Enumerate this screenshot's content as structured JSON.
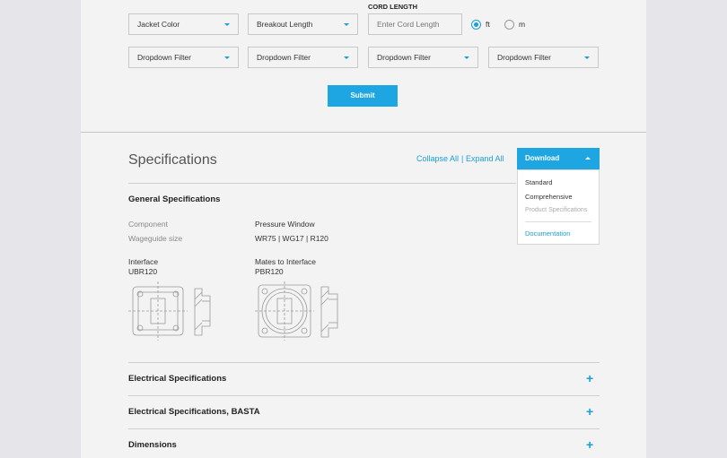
{
  "filters": {
    "row1": [
      {
        "label": "Jacket Color"
      },
      {
        "label": "Breakout Length"
      }
    ],
    "cord_length": {
      "heading": "CORD LENGTH",
      "placeholder": "Enter Cord Length",
      "units": [
        {
          "label": "ft",
          "selected": true
        },
        {
          "label": "m",
          "selected": false
        }
      ]
    },
    "row2": [
      {
        "label": "Dropdown Filter"
      },
      {
        "label": "Dropdown Filter"
      },
      {
        "label": "Dropdown Filter"
      },
      {
        "label": "Dropdown Filter"
      }
    ],
    "submit_label": "Submit"
  },
  "specifications": {
    "title": "Specifications",
    "collapse_all": "Collapse All",
    "separator": "|",
    "expand_all": "Expand All",
    "download": {
      "label": "Download",
      "items": [
        {
          "label": "Standard",
          "enabled": true
        },
        {
          "label": "Comprehensive",
          "enabled": true
        },
        {
          "label": "Product Specifications",
          "enabled": false
        }
      ],
      "documentation": "Documentation"
    },
    "general": {
      "heading": "General Specifications",
      "component_label": "Component",
      "component_value": "Pressure Window",
      "waveguide_label": "Wageguide size",
      "waveguide_value": "WR75 | WG17 | R120",
      "interface_label": "Interface",
      "interface_value": "UBR120",
      "mates_label": "Mates to Interface",
      "mates_value": "PBR120"
    },
    "sections": [
      {
        "title": "Electrical Specifications",
        "icon": "plus-icon"
      },
      {
        "title": "Electrical Specifications, BASTA",
        "icon": "plus-icon"
      },
      {
        "title": "Dimensions",
        "icon": "plus-icon"
      }
    ]
  },
  "colors": {
    "accent": "#1ea6e3",
    "page_bg": "#f3f3f3",
    "outer_bg": "#e6e6ea"
  }
}
